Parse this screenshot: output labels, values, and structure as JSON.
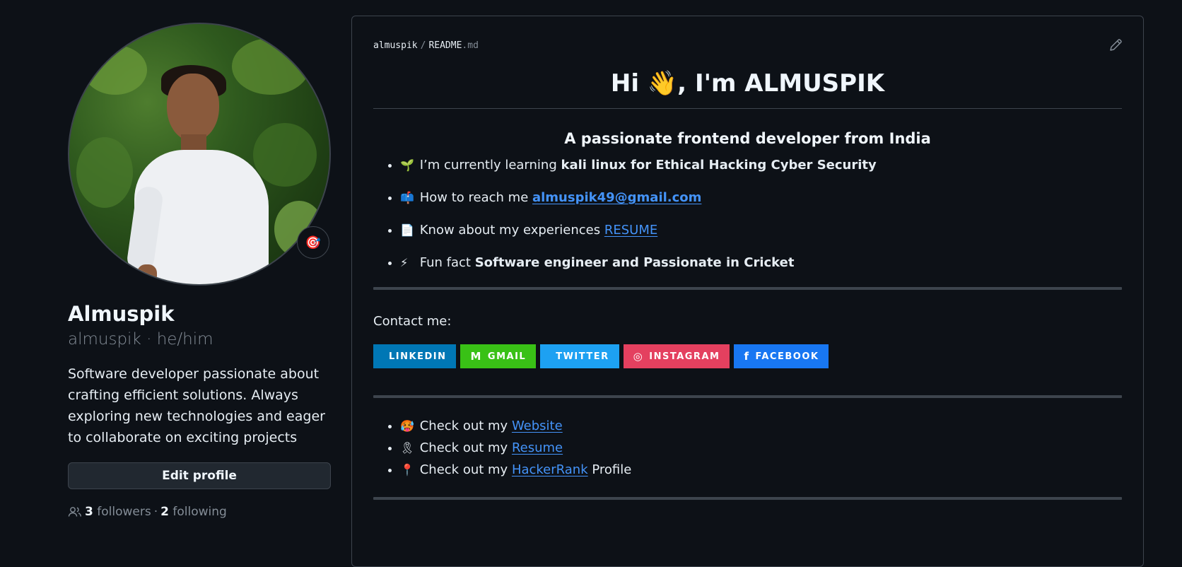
{
  "profile": {
    "name": "Almuspik",
    "login_line": "almuspik · he/him",
    "bio": "Software developer passionate about crafting efficient solutions. Always exploring new technologies and eager to collaborate on exciting projects",
    "edit_button": "Edit profile",
    "followers_count": "3",
    "followers_label": "followers",
    "following_count": "2",
    "following_label": "following",
    "status_icon": "🎯"
  },
  "readme": {
    "crumb_owner": "almuspik",
    "crumb_file": "README",
    "crumb_ext": ".md",
    "heading": "Hi 👋, I'm ALMUSPIK",
    "subheading": "A passionate frontend developer from India",
    "facts": [
      {
        "emoji": "🌱",
        "text": "I’m currently learning ",
        "bold": "kali linux for Ethical Hacking Cyber Security"
      },
      {
        "emoji": "📫",
        "text": "How to reach me ",
        "link": "almuspik49@gmail.com"
      },
      {
        "emoji": "📄",
        "text": "Know about my experiences ",
        "link": "RESUME"
      },
      {
        "emoji": "⚡",
        "text": "Fun fact ",
        "bold": "Software engineer and Passionate in Cricket"
      }
    ],
    "contact_label": "Contact me:",
    "badges": [
      {
        "label": "LINKEDIN",
        "icon": "",
        "color": "#0077b5"
      },
      {
        "label": "GMAIL",
        "icon": "M",
        "color": "#39c116"
      },
      {
        "label": "TWITTER",
        "icon": "",
        "color": "#1da1f2"
      },
      {
        "label": "INSTAGRAM",
        "icon": "◎",
        "color": "#e4405f"
      },
      {
        "label": "FACEBOOK",
        "icon": "f",
        "color": "#1877f2"
      }
    ],
    "links": [
      {
        "emoji": "🥵",
        "prefix": "Check out my ",
        "link": "Website",
        "suffix": ""
      },
      {
        "emoji": "🎗",
        "prefix": "Check out my ",
        "link": "Resume",
        "suffix": ""
      },
      {
        "emoji": "📍",
        "prefix": "Check out my ",
        "link": "HackerRank",
        "suffix": " Profile"
      }
    ]
  }
}
